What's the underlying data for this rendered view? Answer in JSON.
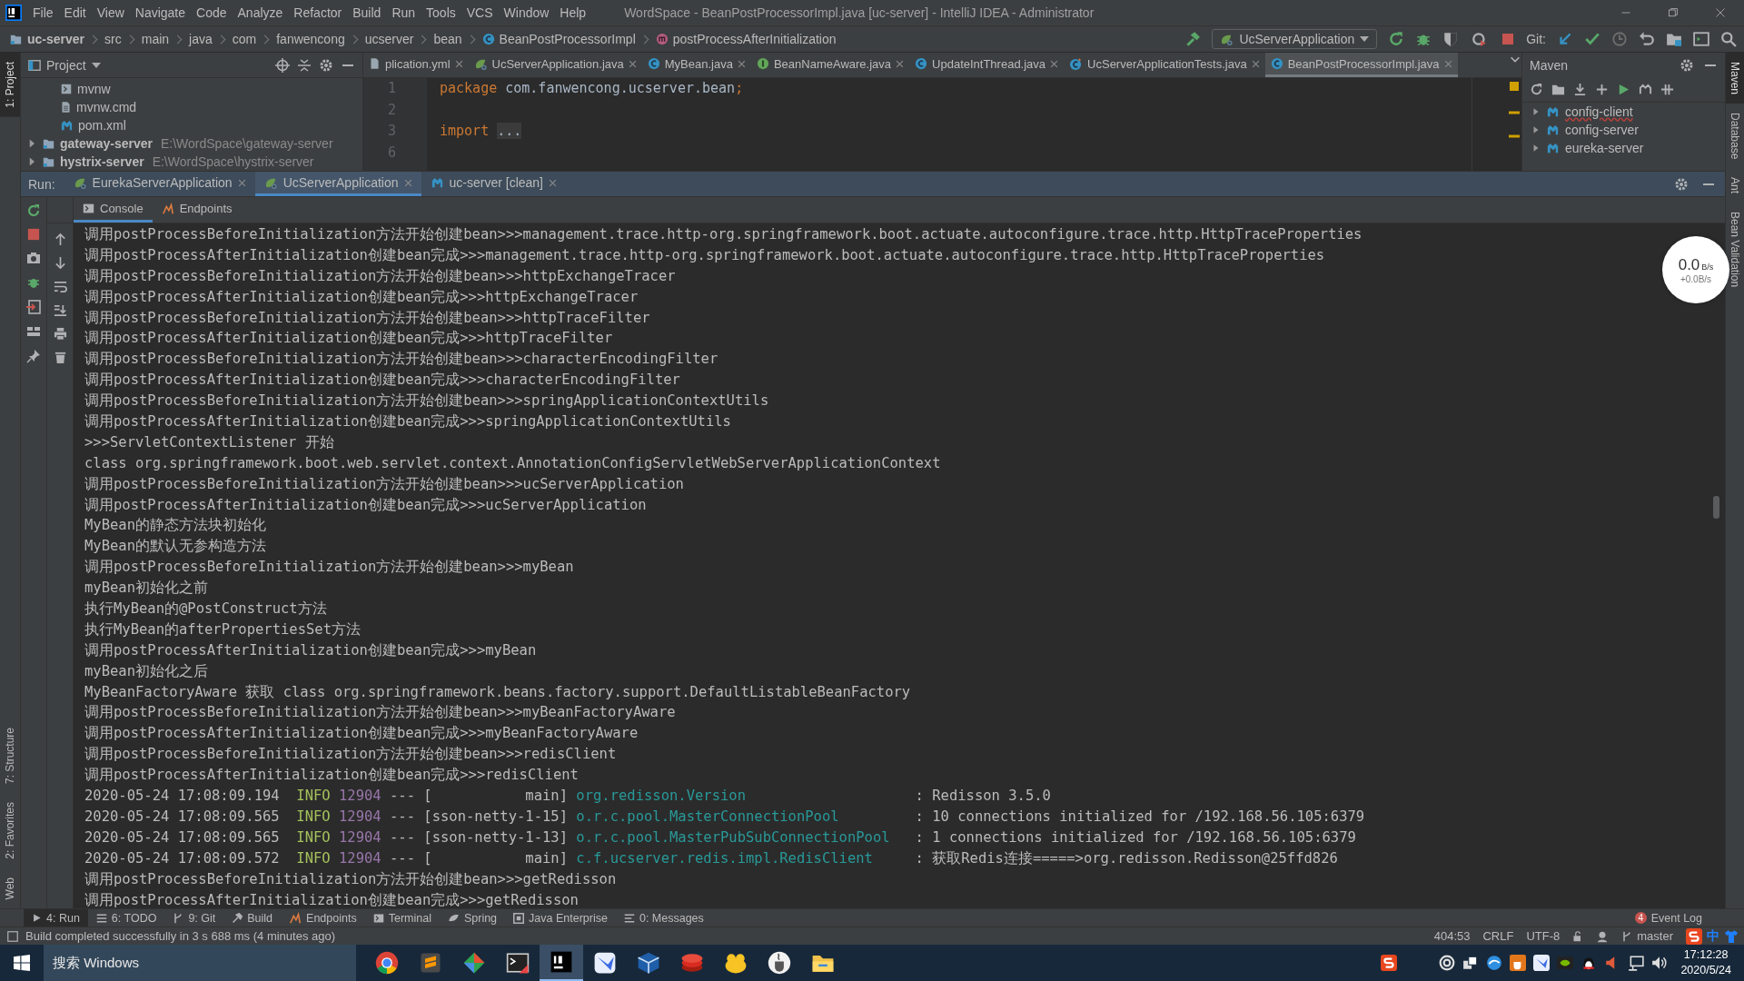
{
  "window": {
    "title": "WordSpace - BeanPostProcessorImpl.java [uc-server] - IntelliJ IDEA - Administrator"
  },
  "menu": [
    "File",
    "Edit",
    "View",
    "Navigate",
    "Code",
    "Analyze",
    "Refactor",
    "Build",
    "Run",
    "Tools",
    "VCS",
    "Window",
    "Help"
  ],
  "breadcrumbs": [
    {
      "kind": "module",
      "label": "uc-server"
    },
    {
      "kind": "dir",
      "label": "src"
    },
    {
      "kind": "dir",
      "label": "main"
    },
    {
      "kind": "dir",
      "label": "java"
    },
    {
      "kind": "dir",
      "label": "com"
    },
    {
      "kind": "dir",
      "label": "fanwencong"
    },
    {
      "kind": "dir",
      "label": "ucserver"
    },
    {
      "kind": "dir",
      "label": "bean"
    },
    {
      "kind": "class",
      "label": "BeanPostProcessorImpl"
    },
    {
      "kind": "method",
      "label": "postProcessAfterInitialization"
    }
  ],
  "toolbar": {
    "run_config": "UcServerApplication",
    "git_label": "Git:"
  },
  "left_strip": {
    "top": [
      {
        "label": "1: Project",
        "selected": true
      }
    ],
    "bottom": [
      {
        "label": "7: Structure",
        "selected": false
      },
      {
        "label": "2: Favorites",
        "selected": false
      },
      {
        "label": "Web",
        "selected": false
      }
    ]
  },
  "right_strip": [
    {
      "label": "Maven",
      "selected": true
    },
    {
      "label": "Database",
      "selected": false
    },
    {
      "label": "Ant",
      "selected": false
    },
    {
      "label": "Bean Validation",
      "selected": false
    }
  ],
  "project": {
    "title": "Project",
    "tree": [
      {
        "children": [
          {
            "kind": "script",
            "name": "mvnw"
          },
          {
            "kind": "file",
            "name": "mvnw.cmd"
          },
          {
            "kind": "maven",
            "name": "pom.xml"
          }
        ]
      },
      {
        "kind": "module",
        "name": "gateway-server",
        "path": "E:\\WordSpace\\gateway-server",
        "expanded": false
      },
      {
        "kind": "module",
        "name": "hystrix-server",
        "path": "E:\\WordSpace\\hystrix-server",
        "expanded": false
      }
    ]
  },
  "editor_tabs": [
    {
      "kind": "yml",
      "label": "plication.yml",
      "selected": false
    },
    {
      "kind": "boot",
      "label": "UcServerApplication.java",
      "selected": false
    },
    {
      "kind": "class",
      "label": "MyBean.java",
      "selected": false
    },
    {
      "kind": "interface",
      "label": "BeanNameAware.java",
      "selected": false
    },
    {
      "kind": "class",
      "label": "UpdateIntThread.java",
      "selected": false
    },
    {
      "kind": "test",
      "label": "UcServerApplicationTests.java",
      "selected": false
    },
    {
      "kind": "class",
      "label": "BeanPostProcessorImpl.java",
      "selected": true
    }
  ],
  "editor_lines": [
    {
      "number": "1",
      "tokens": [
        {
          "kind": "keyword",
          "text": "package"
        },
        {
          "kind": "plain",
          "text": " com.fanwencong.ucserver.bean"
        },
        {
          "kind": "keyword",
          "text": ";"
        }
      ]
    },
    {
      "number": "2"
    },
    {
      "number": "3",
      "folded": true,
      "tokens": [
        {
          "kind": "keyword",
          "text": "import"
        },
        {
          "kind": "fold",
          "text": "..."
        }
      ]
    },
    {
      "number": "6"
    }
  ],
  "maven": {
    "title": "Maven",
    "projects": [
      {
        "name": "config-client",
        "misspelled": true
      },
      {
        "name": "config-server",
        "misspelled": false
      },
      {
        "name": "eureka-server",
        "misspelled": false
      }
    ]
  },
  "run": {
    "label": "Run:",
    "tabs": [
      {
        "kind": "boot",
        "label": "EurekaServerApplication",
        "selected": false
      },
      {
        "kind": "boot",
        "label": "UcServerApplication",
        "selected": true
      },
      {
        "kind": "maven",
        "label": "uc-server [clean]",
        "selected": false
      }
    ],
    "subtabs": [
      {
        "kind": "console",
        "label": "Console",
        "selected": true
      },
      {
        "kind": "endpoints",
        "label": "Endpoints",
        "selected": false
      }
    ]
  },
  "console": [
    {
      "kind": "text",
      "text": "调用postProcessBeforeInitialization方法开始创建bean>>>management.trace.http-org.springframework.boot.actuate.autoconfigure.trace.http.HttpTraceProperties"
    },
    {
      "kind": "text",
      "text": "调用postProcessAfterInitialization创建bean完成>>>management.trace.http-org.springframework.boot.actuate.autoconfigure.trace.http.HttpTraceProperties"
    },
    {
      "kind": "text",
      "text": "调用postProcessBeforeInitialization方法开始创建bean>>>httpExchangeTracer"
    },
    {
      "kind": "text",
      "text": "调用postProcessAfterInitialization创建bean完成>>>httpExchangeTracer"
    },
    {
      "kind": "text",
      "text": "调用postProcessBeforeInitialization方法开始创建bean>>>httpTraceFilter"
    },
    {
      "kind": "text",
      "text": "调用postProcessAfterInitialization创建bean完成>>>httpTraceFilter"
    },
    {
      "kind": "text",
      "text": "调用postProcessBeforeInitialization方法开始创建bean>>>characterEncodingFilter"
    },
    {
      "kind": "text",
      "text": "调用postProcessAfterInitialization创建bean完成>>>characterEncodingFilter"
    },
    {
      "kind": "text",
      "text": "调用postProcessBeforeInitialization方法开始创建bean>>>springApplicationContextUtils"
    },
    {
      "kind": "text",
      "text": "调用postProcessAfterInitialization创建bean完成>>>springApplicationContextUtils"
    },
    {
      "kind": "text",
      "text": ">>>ServletContextListener 开始"
    },
    {
      "kind": "text",
      "text": "class org.springframework.boot.web.servlet.context.AnnotationConfigServletWebServerApplicationContext"
    },
    {
      "kind": "text",
      "text": "调用postProcessBeforeInitialization方法开始创建bean>>>ucServerApplication"
    },
    {
      "kind": "text",
      "text": "调用postProcessAfterInitialization创建bean完成>>>ucServerApplication"
    },
    {
      "kind": "text",
      "text": "MyBean的静态方法块初始化"
    },
    {
      "kind": "text",
      "text": "MyBean的默认无参构造方法"
    },
    {
      "kind": "text",
      "text": "调用postProcessBeforeInitialization方法开始创建bean>>>myBean"
    },
    {
      "kind": "text",
      "text": "myBean初始化之前"
    },
    {
      "kind": "text",
      "text": "执行MyBean的@PostConstruct方法"
    },
    {
      "kind": "text",
      "text": "执行MyBean的afterPropertiesSet方法"
    },
    {
      "kind": "text",
      "text": "调用postProcessAfterInitialization创建bean完成>>>myBean"
    },
    {
      "kind": "text",
      "text": "myBean初始化之后"
    },
    {
      "kind": "text",
      "text": "MyBeanFactoryAware 获取 class org.springframework.beans.factory.support.DefaultListableBeanFactory"
    },
    {
      "kind": "text",
      "text": "调用postProcessBeforeInitialization方法开始创建bean>>>myBeanFactoryAware"
    },
    {
      "kind": "text",
      "text": "调用postProcessAfterInitialization创建bean完成>>>myBeanFactoryAware"
    },
    {
      "kind": "text",
      "text": "调用postProcessBeforeInitialization方法开始创建bean>>>redisClient"
    },
    {
      "kind": "text",
      "text": "调用postProcessAfterInitialization创建bean完成>>>redisClient"
    },
    {
      "kind": "log",
      "time": "2020-05-24 17:08:09.194",
      "level": "INFO",
      "pid": "12904",
      "sep": "---",
      "thread": "[           main]",
      "logger": "org.redisson.Version",
      "message": ": Redisson 3.5.0"
    },
    {
      "kind": "log",
      "time": "2020-05-24 17:08:09.565",
      "level": "INFO",
      "pid": "12904",
      "sep": "---",
      "thread": "[sson-netty-1-15]",
      "logger": "o.r.c.pool.MasterConnectionPool",
      "message": ": 10 connections initialized for /192.168.56.105:6379"
    },
    {
      "kind": "log",
      "time": "2020-05-24 17:08:09.565",
      "level": "INFO",
      "pid": "12904",
      "sep": "---",
      "thread": "[sson-netty-1-13]",
      "logger": "o.r.c.pool.MasterPubSubConnectionPool",
      "message": ": 1 connections initialized for /192.168.56.105:6379"
    },
    {
      "kind": "log",
      "time": "2020-05-24 17:08:09.572",
      "level": "INFO",
      "pid": "12904",
      "sep": "---",
      "thread": "[           main]",
      "logger": "c.f.ucserver.redis.impl.RedisClient",
      "message": ": 获取Redis连接=====>org.redisson.Redisson@25ffd826"
    },
    {
      "kind": "text",
      "text": "调用postProcessBeforeInitialization方法开始创建bean>>>getRedisson"
    },
    {
      "kind": "text",
      "text": "调用postProcessAfterInitialization创建bean完成>>>getRedisson"
    }
  ],
  "net_widget": {
    "speed": "0.0",
    "unit": "B/s",
    "upload": "+0.0B/s"
  },
  "tool_tabs": [
    {
      "kind": "run",
      "label": "4: Run",
      "selected": true
    },
    {
      "kind": "todo",
      "label": "6: TODO",
      "selected": false
    },
    {
      "kind": "git",
      "label": "9: Git",
      "selected": false
    },
    {
      "kind": "build",
      "label": "Build",
      "selected": false
    },
    {
      "kind": "endpoints",
      "label": "Endpoints",
      "selected": false
    },
    {
      "kind": "terminal",
      "label": "Terminal",
      "selected": false
    },
    {
      "kind": "spring",
      "label": "Spring",
      "selected": false
    },
    {
      "kind": "enterprise",
      "label": "Java Enterprise",
      "selected": false
    },
    {
      "kind": "messages",
      "label": "0: Messages",
      "selected": false
    }
  ],
  "event_log": {
    "label": "Event Log",
    "count": "4"
  },
  "status_bar": {
    "message": "Build completed successfully in 3 s 688 ms (4 minutes ago)",
    "position": "404:53",
    "line_sep": "CRLF",
    "encoding": "UTF-8",
    "branch": "master",
    "ime": "中"
  },
  "taskbar": {
    "search": "搜索 Windows",
    "apps": [
      {
        "kind": "browser",
        "selected": false
      },
      {
        "kind": "editor",
        "selected": false
      },
      {
        "kind": "git",
        "selected": false
      },
      {
        "kind": "terminal",
        "selected": false
      },
      {
        "kind": "ide",
        "selected": true
      },
      {
        "kind": "bird",
        "selected": false
      },
      {
        "kind": "cube",
        "selected": false
      },
      {
        "kind": "redis",
        "selected": false
      },
      {
        "kind": "chick",
        "selected": false
      },
      {
        "kind": "java",
        "selected": false
      },
      {
        "kind": "folder",
        "selected": false
      }
    ],
    "time": "17:12:28",
    "date": "2020/5/24"
  }
}
